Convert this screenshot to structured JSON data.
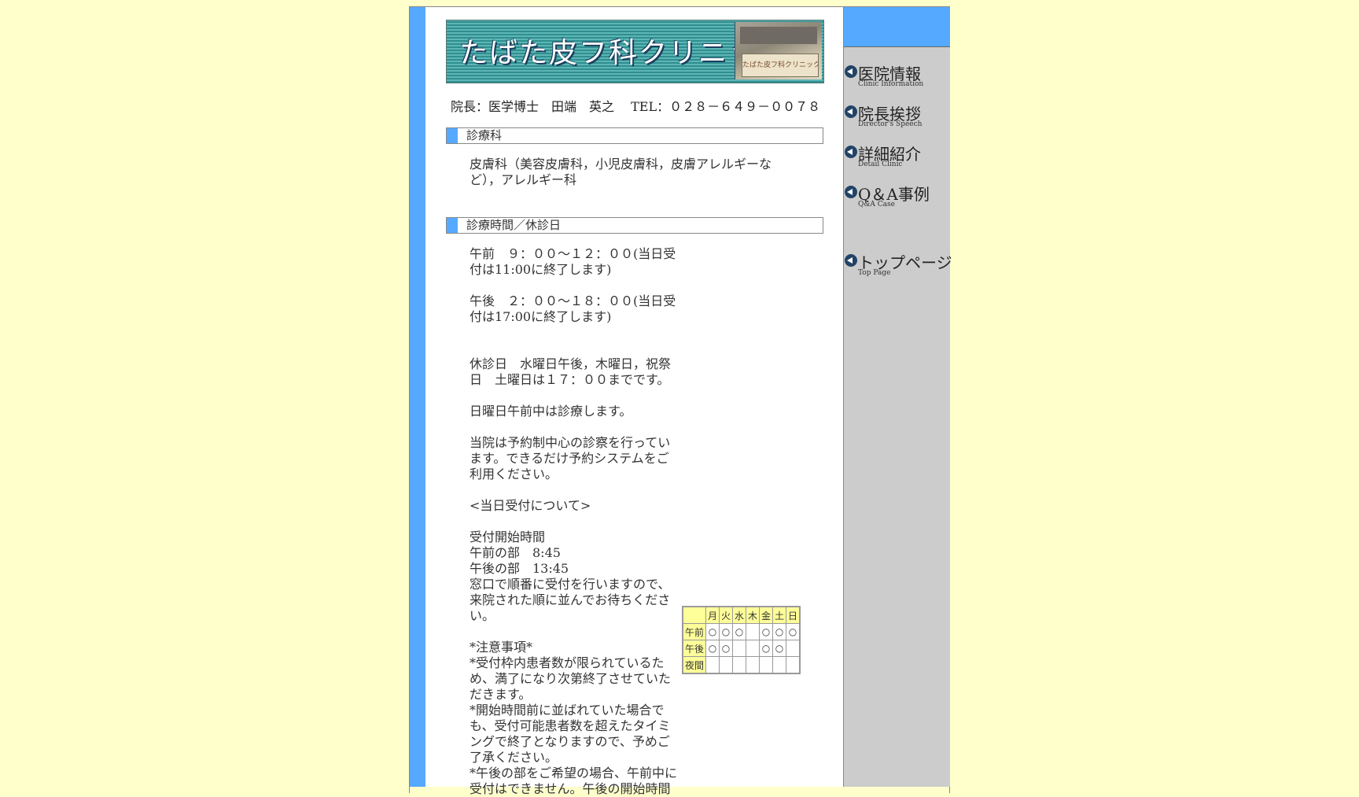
{
  "banner": {
    "title": "たばた皮フ科クリニック",
    "sign_text": "たばた皮フ科クリニック"
  },
  "director_line": "院長：医学博士　田端　英之　 TEL：０２８－６４９－００７８",
  "sections": {
    "department": {
      "heading": "診療科",
      "lines": [
        "皮膚科（美容皮膚科，小児皮膚科，皮膚アレルギーな",
        "ど），アレルギー科"
      ]
    },
    "hours": {
      "heading": "診療時間／休診日",
      "lines": [
        "午前　９：００～１２：００(当日受",
        "付は11:00に終了します)",
        "",
        "午後　２：００～１８：００(当日受",
        "付は17:00に終了します)",
        "",
        "",
        "休診日　水曜日午後，木曜日，祝祭",
        "日　土曜日は１７：００までです。",
        "",
        "日曜日午前中は診療します。",
        "",
        "当院は予約制中心の診察を行ってい",
        "ます。できるだけ予約システムをご",
        "利用ください。",
        "",
        "<当日受付について>",
        "",
        "受付開始時間",
        "午前の部　8:45",
        "午後の部　13:45",
        "窓口で順番に受付を行いますので、",
        "来院された順に並んでお待ちくださ",
        "い。",
        "",
        "*注意事項*",
        "*受付枠内患者数が限られているた",
        "め、満了になり次第終了させていた",
        "だきます。",
        "*開始時間前に並ばれていた場合で",
        "も、受付可能患者数を超えたタイミ",
        "ングで終了となりますので、予めご",
        "了承ください。",
        "*午後の部をご希望の場合、午前中に",
        "受付はできません。午後の開始時間"
      ]
    }
  },
  "schedule": {
    "days": [
      "月",
      "火",
      "水",
      "木",
      "金",
      "土",
      "日"
    ],
    "rows": [
      {
        "label": "午前",
        "cells": [
          "○",
          "○",
          "○",
          "",
          "○",
          "○",
          "○"
        ]
      },
      {
        "label": "午後",
        "cells": [
          "○",
          "○",
          "",
          "",
          "○",
          "○",
          ""
        ]
      },
      {
        "label": "夜間",
        "cells": [
          "",
          "",
          "",
          "",
          "",
          "",
          ""
        ]
      }
    ]
  },
  "nav": {
    "items": [
      {
        "label": "医院情報",
        "sub": "Clinic Information"
      },
      {
        "label": "院長挨拶",
        "sub": "Director's Speech"
      },
      {
        "label": "詳細紹介",
        "sub": "Detail Clinic"
      },
      {
        "label": "Q＆A事例",
        "sub": "Q&A Case"
      },
      {
        "label": "トップページ",
        "sub": "Top Page"
      }
    ]
  },
  "colors": {
    "page_bg": "#ffffcc",
    "accent_blue": "#55aaff",
    "nav_bg": "#cccccc",
    "table_header": "#ffff99"
  }
}
